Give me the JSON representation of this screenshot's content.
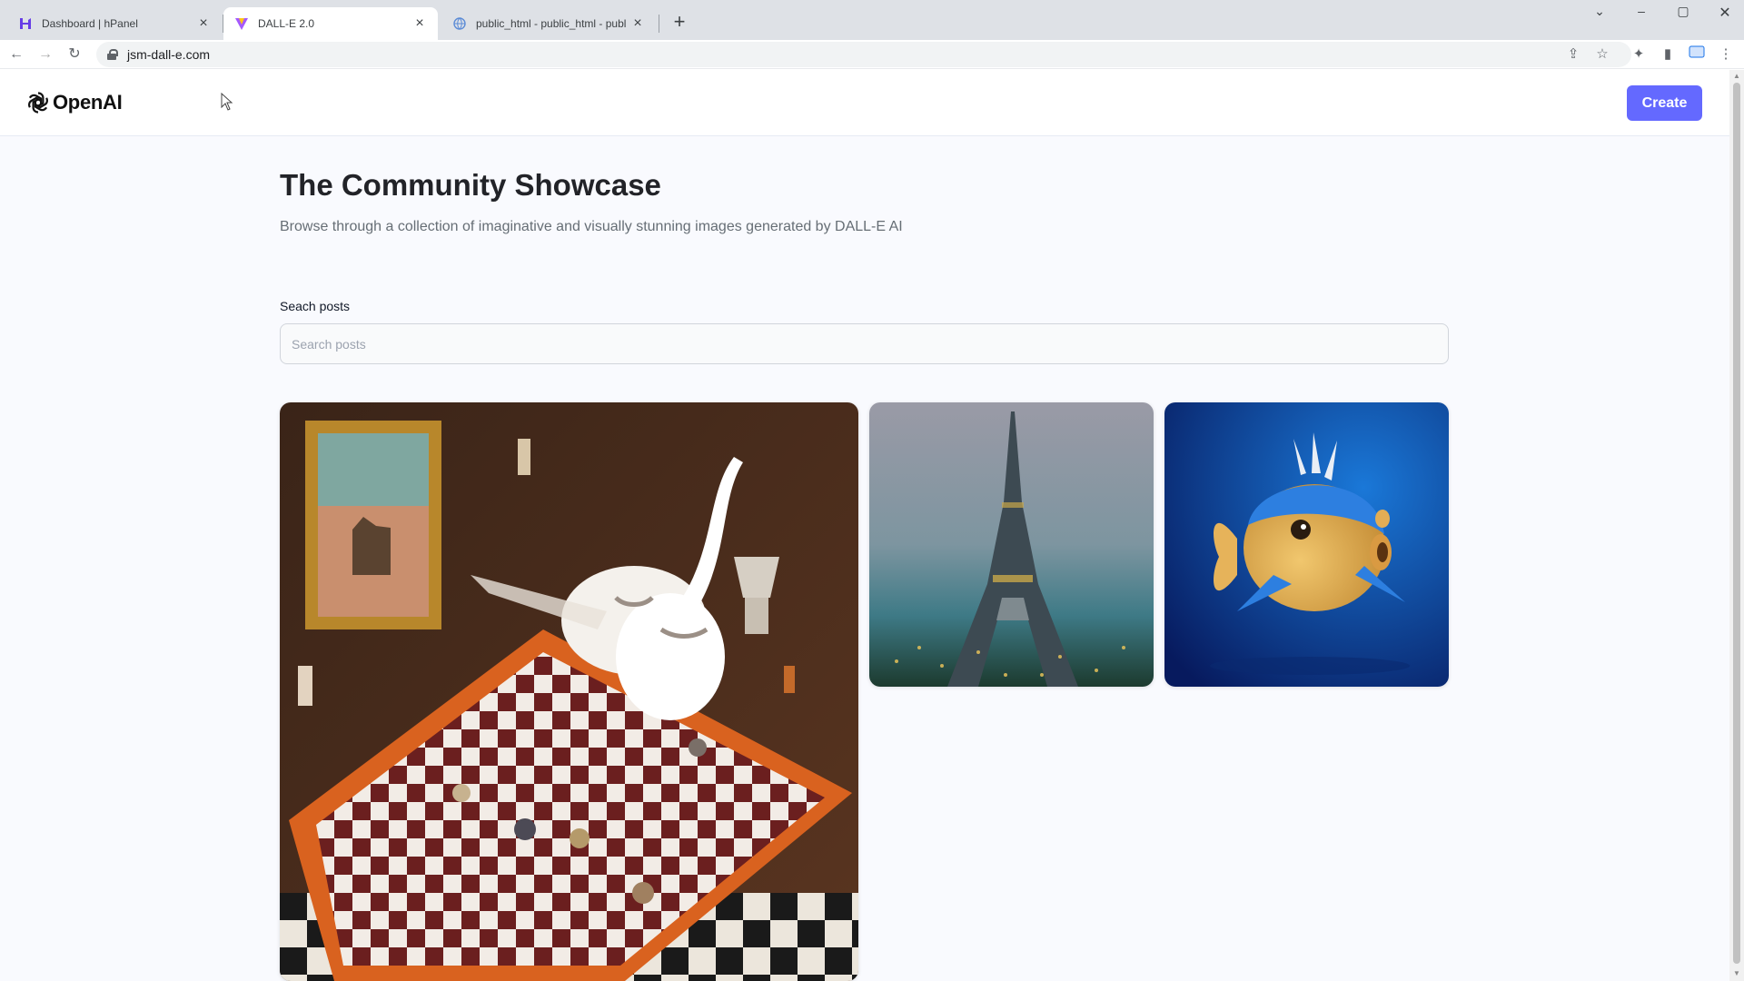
{
  "browser": {
    "tabs": [
      {
        "title": "Dashboard | hPanel",
        "active": false
      },
      {
        "title": "DALL-E 2.0",
        "active": true
      },
      {
        "title": "public_html - public_html - publ",
        "active": false
      }
    ],
    "url": "jsm-dall-e.com"
  },
  "header": {
    "logo_text": "OpenAI",
    "create_label": "Create"
  },
  "main": {
    "title": "The Community Showcase",
    "subtitle": "Browse through a collection of imaginative and visually stunning images generated by DALL-E AI",
    "search": {
      "label": "Seach posts",
      "placeholder": "Search posts",
      "value": ""
    }
  },
  "colors": {
    "accent": "#6469ff",
    "page_bg": "#f9fafe"
  }
}
